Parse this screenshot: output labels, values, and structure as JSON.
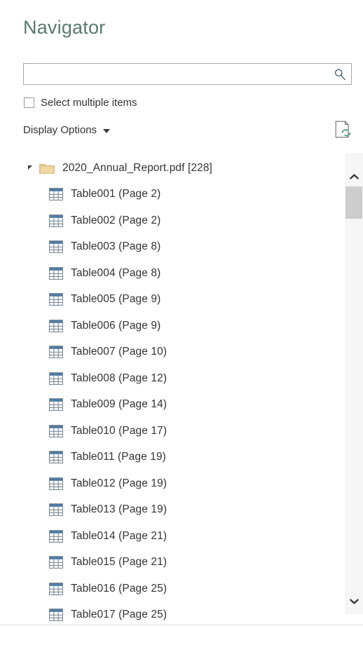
{
  "dialog": {
    "title": "Navigator"
  },
  "search": {
    "value": "",
    "placeholder": "",
    "icon": "search-icon"
  },
  "options": {
    "select_multiple_label": "Select multiple items",
    "select_multiple_checked": false,
    "display_options_label": "Display Options",
    "display_options_caret": "chevron-down-icon",
    "refresh_icon": "refresh-document-icon"
  },
  "tree": {
    "root": {
      "icon": "folder-icon",
      "name": "2020_Annual_Report.pdf",
      "count": "[228]",
      "label": "2020_Annual_Report.pdf [228]",
      "expanded": true,
      "expander_icon": "triangle-expanded-icon"
    },
    "items": [
      {
        "icon": "table-icon",
        "label": "Table001 (Page 2)"
      },
      {
        "icon": "table-icon",
        "label": "Table002 (Page 2)"
      },
      {
        "icon": "table-icon",
        "label": "Table003 (Page 8)"
      },
      {
        "icon": "table-icon",
        "label": "Table004 (Page 8)"
      },
      {
        "icon": "table-icon",
        "label": "Table005 (Page 9)"
      },
      {
        "icon": "table-icon",
        "label": "Table006 (Page 9)"
      },
      {
        "icon": "table-icon",
        "label": "Table007 (Page 10)"
      },
      {
        "icon": "table-icon",
        "label": "Table008 (Page 12)"
      },
      {
        "icon": "table-icon",
        "label": "Table009 (Page 14)"
      },
      {
        "icon": "table-icon",
        "label": "Table010 (Page 17)"
      },
      {
        "icon": "table-icon",
        "label": "Table011 (Page 19)"
      },
      {
        "icon": "table-icon",
        "label": "Table012 (Page 19)"
      },
      {
        "icon": "table-icon",
        "label": "Table013 (Page 19)"
      },
      {
        "icon": "table-icon",
        "label": "Table014 (Page 21)"
      },
      {
        "icon": "table-icon",
        "label": "Table015 (Page 21)"
      },
      {
        "icon": "table-icon",
        "label": "Table016 (Page 25)"
      },
      {
        "icon": "table-icon",
        "label": "Table017 (Page 25)"
      }
    ]
  },
  "scrollbar": {
    "up_icon": "chevron-up-icon",
    "down_icon": "chevron-down-icon"
  },
  "colors": {
    "title": "#5a7a6c",
    "text": "#333333",
    "border": "#a8a8a8",
    "folder": "#e8c992",
    "table_header": "#4a7ba8",
    "refresh": "#4f7d6e",
    "scrollbar_thumb": "#cdcdcd",
    "scrollbar_track": "#f6f6f6"
  }
}
